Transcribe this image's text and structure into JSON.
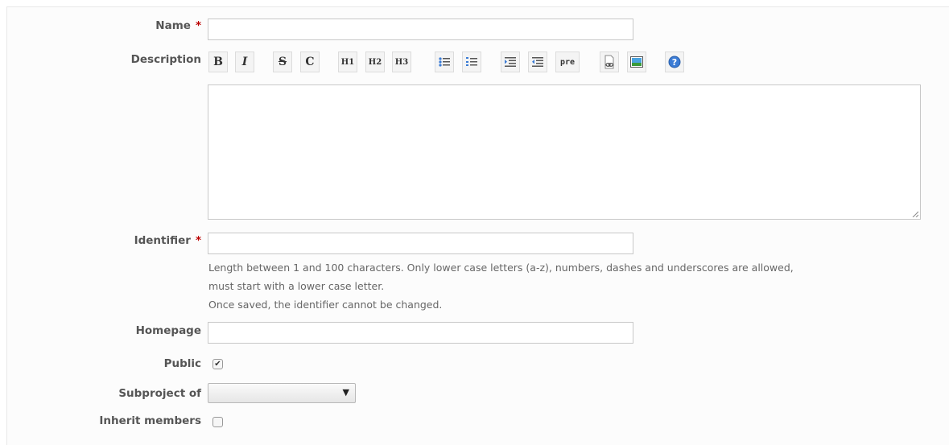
{
  "form": {
    "name_label": "Name",
    "required_mark": "*",
    "description_label": "Description",
    "identifier_label": "Identifier",
    "identifier_hint_line1": "Length between 1 and 100 characters. Only lower case letters (a-z), numbers, dashes and underscores are allowed,",
    "identifier_hint_line2": "must start with a lower case letter.",
    "identifier_hint_line3": "Once saved, the identifier cannot be changed.",
    "homepage_label": "Homepage",
    "public_label": "Public",
    "public_checked": true,
    "subproject_label": "Subproject of",
    "subproject_value": "",
    "inherit_label": "Inherit members",
    "inherit_checked": false,
    "name_value": "",
    "description_value": "",
    "identifier_value": "",
    "homepage_value": ""
  },
  "toolbar": {
    "bold": "B",
    "italic": "I",
    "strike": "S",
    "code": "C",
    "h1": "H1",
    "h2": "H2",
    "h3": "H3",
    "pre": "pre",
    "icons": [
      "unordered-list-icon",
      "ordered-list-icon",
      "indent-icon",
      "outdent-icon",
      "link-icon",
      "image-icon",
      "help-icon"
    ]
  }
}
